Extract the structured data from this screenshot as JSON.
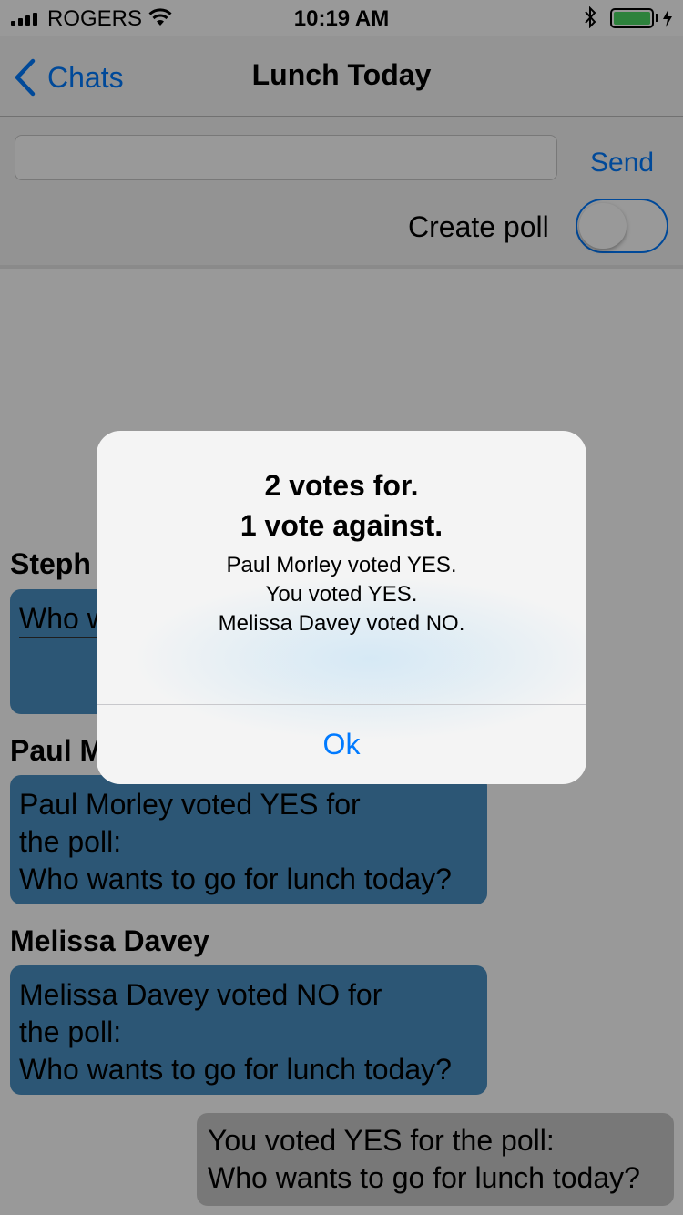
{
  "status_bar": {
    "carrier": "ROGERS",
    "time": "10:19 AM",
    "signal_icon": "signal-bars-icon",
    "wifi_icon": "wifi-icon",
    "bluetooth_icon": "bluetooth-icon",
    "battery_icon": "battery-icon",
    "charging_icon": "bolt-icon",
    "battery_level": 1.0
  },
  "nav": {
    "back_label": "Chats",
    "back_icon": "chevron-left-icon",
    "title": "Lunch Today"
  },
  "composer": {
    "input_value": "",
    "send_label": "Send",
    "poll_label": "Create poll",
    "poll_enabled": false
  },
  "messages": [
    {
      "sender": "Steph",
      "lines": [
        "Who w"
      ]
    },
    {
      "sender": "Paul M",
      "lines": [
        "Paul Morley voted YES for",
        "the poll:",
        "Who wants to go for lunch today?"
      ]
    },
    {
      "sender": "Melissa Davey",
      "lines": [
        "Melissa Davey voted NO for",
        "the poll:",
        "Who wants to go for lunch today?"
      ]
    },
    {
      "sender": "",
      "lines": [
        "You voted YES for the poll:",
        "Who wants to go for lunch today?"
      ]
    }
  ],
  "alert": {
    "title_line1": "2 votes for.",
    "title_line2": "1 vote against.",
    "message_lines": [
      "Paul Morley voted YES.",
      "You voted YES.",
      "Melissa Davey voted NO."
    ],
    "ok_label": "Ok"
  },
  "colors": {
    "accent": "#007aff",
    "bubble_incoming": "#4a8fc3",
    "bubble_outgoing": "#c9c9c9",
    "battery": "#4cd964"
  }
}
